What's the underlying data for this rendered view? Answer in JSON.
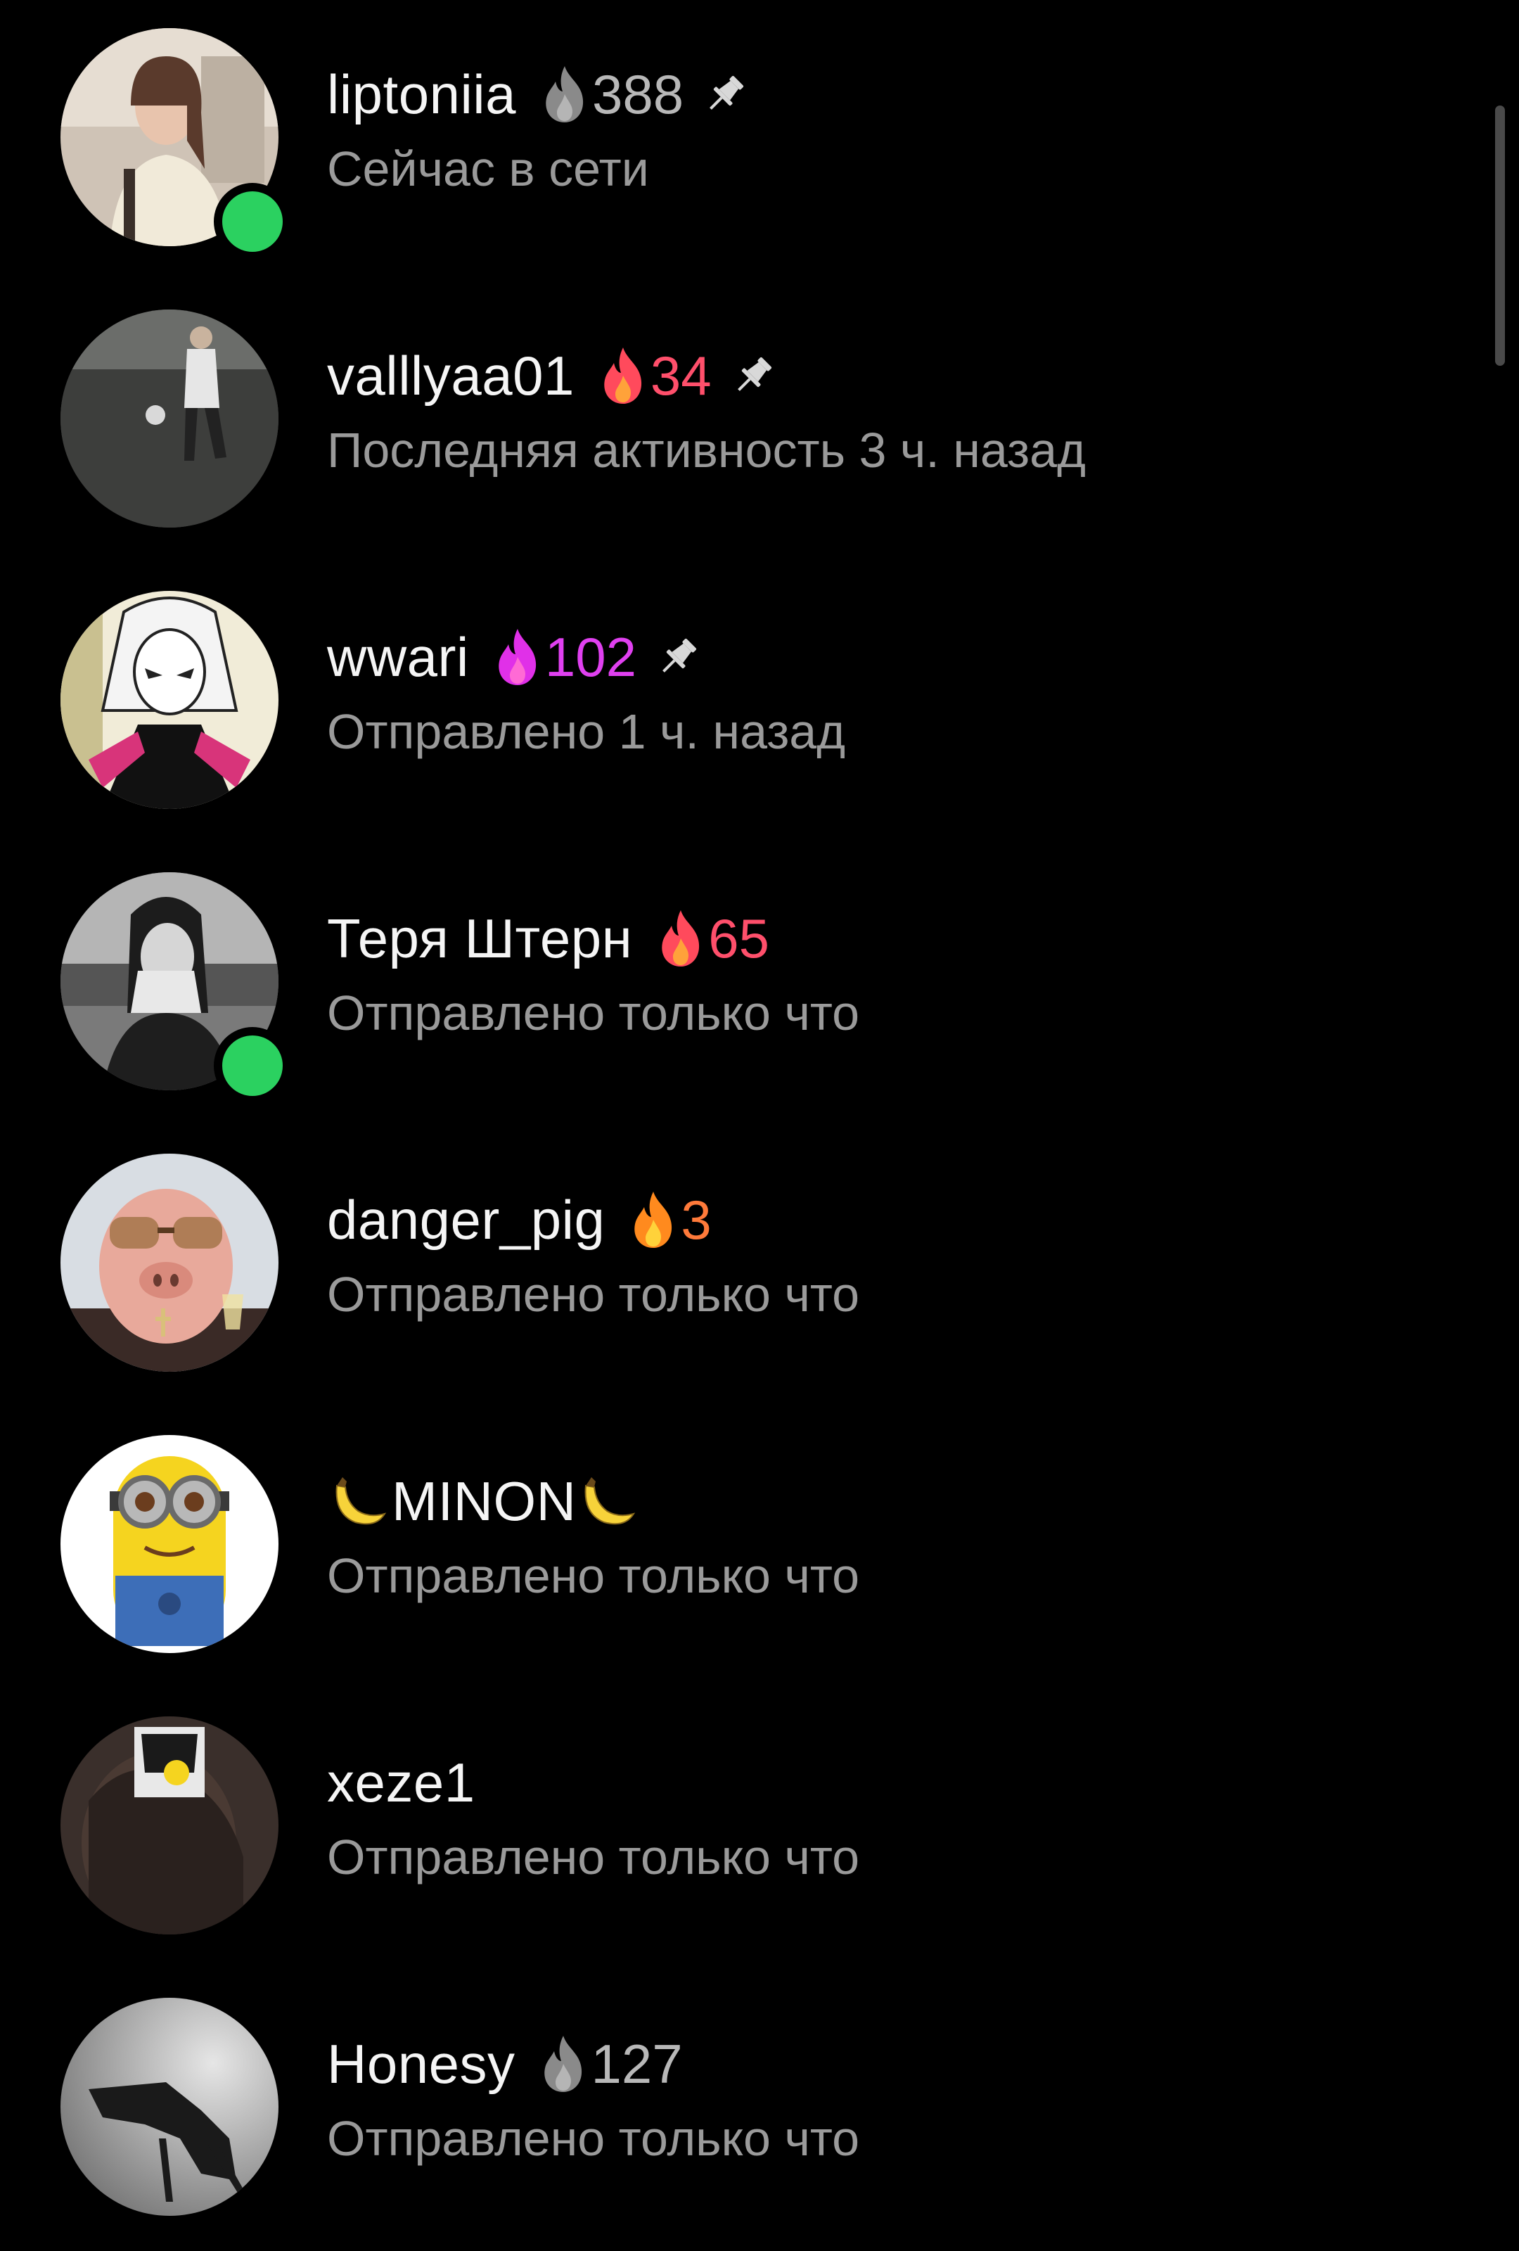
{
  "colors": {
    "background": "#000000",
    "online": "#2bd160",
    "status_text": "#9a9a9a",
    "name_text": "#f5f5f5"
  },
  "chats": [
    {
      "username": "liptoniia",
      "streak": {
        "count": "388",
        "flame_color": "#8a8a8a",
        "count_color": "#b8b8b8",
        "flame_icon": "gray-flame-icon"
      },
      "pinned": true,
      "online": true,
      "status": "Сейчас в сети"
    },
    {
      "username": "valllyaa01",
      "streak": {
        "count": "34",
        "flame_color": "#ff4a5c",
        "count_color": "#ff4f6b",
        "flame_icon": "red-flame-icon"
      },
      "pinned": true,
      "online": false,
      "status": "Последняя активность 3 ч. назад"
    },
    {
      "username": "wwari",
      "streak": {
        "count": "102",
        "flame_color": "#e030e8",
        "count_color": "#e040f0",
        "flame_icon": "purple-flame-icon"
      },
      "pinned": true,
      "online": false,
      "status": "Отправлено 1 ч. назад"
    },
    {
      "username": "Теря Штерн",
      "streak": {
        "count": "65",
        "flame_color": "#ff4a5c",
        "count_color": "#ff4f6b",
        "flame_icon": "red-flame-icon"
      },
      "pinned": false,
      "online": true,
      "status": "Отправлено только что"
    },
    {
      "username": "danger_pig",
      "streak": {
        "count": "3",
        "flame_color": "#ffa21e",
        "count_color": "#ff7a3a",
        "flame_icon": "orange-flame-icon"
      },
      "pinned": false,
      "online": false,
      "status": "Отправлено только что"
    },
    {
      "username": "MINON",
      "username_decoration": "banana-emoji",
      "pinned": false,
      "online": false,
      "status": "Отправлено только что"
    },
    {
      "username": "xeze1",
      "pinned": false,
      "online": false,
      "status": "Отправлено только что"
    },
    {
      "username": "Honesy",
      "streak": {
        "count": "127",
        "flame_color": "#8a8a8a",
        "count_color": "#b8b8b8",
        "flame_icon": "gray-flame-icon"
      },
      "pinned": false,
      "online": false,
      "status": "Отправлено только что"
    }
  ]
}
